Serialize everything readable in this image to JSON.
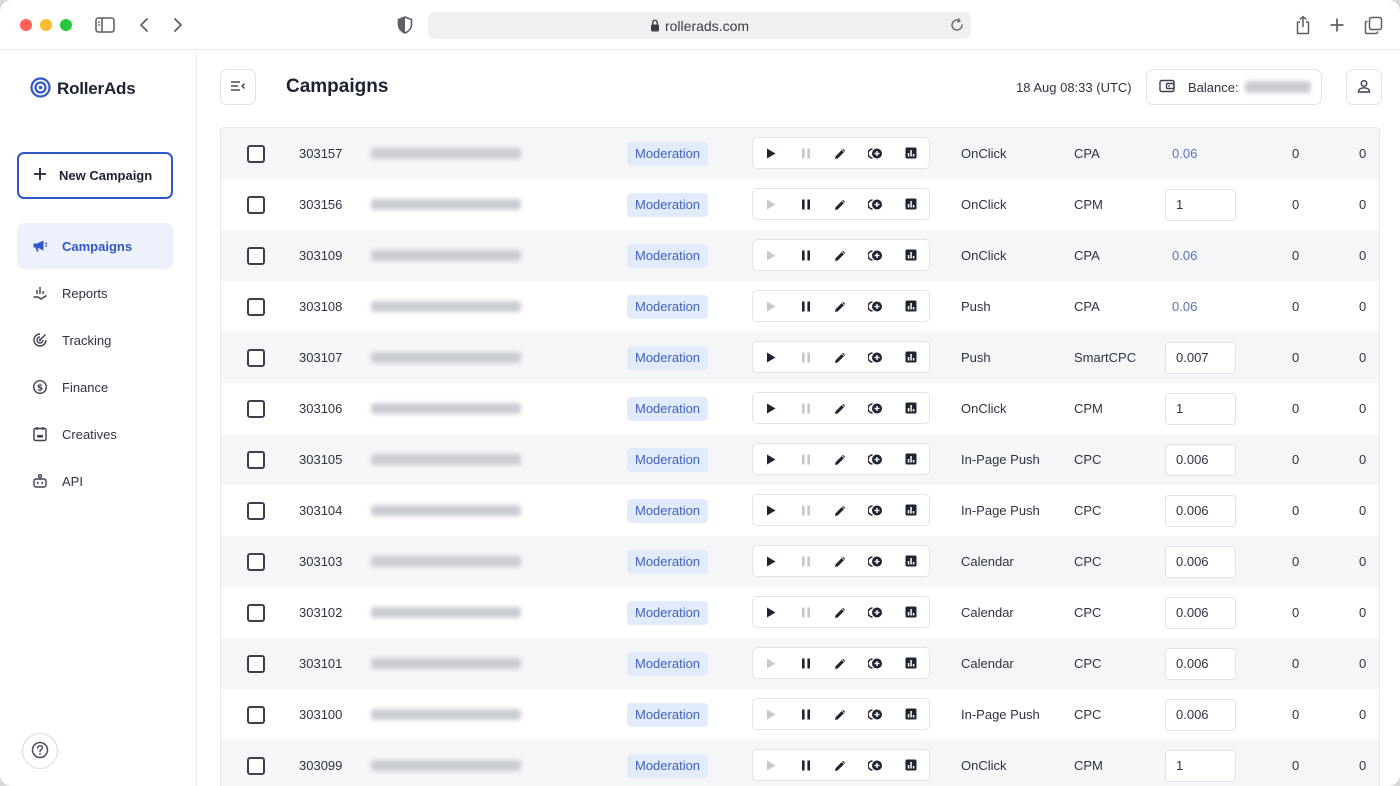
{
  "browser": {
    "url": "rollerads.com"
  },
  "sidebar": {
    "brand": "RollerAds",
    "new_campaign_label": "New Campaign",
    "items": [
      {
        "label": "Campaigns",
        "icon": "megaphone-icon",
        "active": true
      },
      {
        "label": "Reports",
        "icon": "chart-hand-icon",
        "active": false
      },
      {
        "label": "Tracking",
        "icon": "tracking-icon",
        "active": false
      },
      {
        "label": "Finance",
        "icon": "dollar-icon",
        "active": false
      },
      {
        "label": "Creatives",
        "icon": "creatives-icon",
        "active": false
      },
      {
        "label": "API",
        "icon": "api-icon",
        "active": false
      }
    ]
  },
  "header": {
    "title": "Campaigns",
    "datetime": "18 Aug 08:33 (UTC)",
    "balance_label": "Balance:"
  },
  "table": {
    "status_label": "Moderation",
    "rows": [
      {
        "id": "303157",
        "play": true,
        "pause": false,
        "type": "OnClick",
        "model": "CPA",
        "bid": "0.06",
        "bid_input": false,
        "n1": "0",
        "n2": "0"
      },
      {
        "id": "303156",
        "play": false,
        "pause": true,
        "type": "OnClick",
        "model": "CPM",
        "bid": "1",
        "bid_input": true,
        "n1": "0",
        "n2": "0"
      },
      {
        "id": "303109",
        "play": false,
        "pause": true,
        "type": "OnClick",
        "model": "CPA",
        "bid": "0.06",
        "bid_input": false,
        "n1": "0",
        "n2": "0"
      },
      {
        "id": "303108",
        "play": false,
        "pause": true,
        "type": "Push",
        "model": "CPA",
        "bid": "0.06",
        "bid_input": false,
        "n1": "0",
        "n2": "0"
      },
      {
        "id": "303107",
        "play": true,
        "pause": false,
        "type": "Push",
        "model": "SmartCPC",
        "bid": "0.007",
        "bid_input": true,
        "n1": "0",
        "n2": "0"
      },
      {
        "id": "303106",
        "play": true,
        "pause": false,
        "type": "OnClick",
        "model": "CPM",
        "bid": "1",
        "bid_input": true,
        "n1": "0",
        "n2": "0"
      },
      {
        "id": "303105",
        "play": true,
        "pause": false,
        "type": "In-Page Push",
        "model": "CPC",
        "bid": "0.006",
        "bid_input": true,
        "n1": "0",
        "n2": "0"
      },
      {
        "id": "303104",
        "play": true,
        "pause": false,
        "type": "In-Page Push",
        "model": "CPC",
        "bid": "0.006",
        "bid_input": true,
        "n1": "0",
        "n2": "0"
      },
      {
        "id": "303103",
        "play": true,
        "pause": false,
        "type": "Calendar",
        "model": "CPC",
        "bid": "0.006",
        "bid_input": true,
        "n1": "0",
        "n2": "0"
      },
      {
        "id": "303102",
        "play": true,
        "pause": false,
        "type": "Calendar",
        "model": "CPC",
        "bid": "0.006",
        "bid_input": true,
        "n1": "0",
        "n2": "0"
      },
      {
        "id": "303101",
        "play": false,
        "pause": true,
        "type": "Calendar",
        "model": "CPC",
        "bid": "0.006",
        "bid_input": true,
        "n1": "0",
        "n2": "0"
      },
      {
        "id": "303100",
        "play": false,
        "pause": true,
        "type": "In-Page Push",
        "model": "CPC",
        "bid": "0.006",
        "bid_input": true,
        "n1": "0",
        "n2": "0"
      },
      {
        "id": "303099",
        "play": false,
        "pause": true,
        "type": "OnClick",
        "model": "CPM",
        "bid": "1",
        "bid_input": true,
        "n1": "0",
        "n2": "0"
      }
    ]
  },
  "colors": {
    "accent": "#2f57c9",
    "badge_bg": "#e2ebfb",
    "badge_text": "#3f62bd"
  }
}
